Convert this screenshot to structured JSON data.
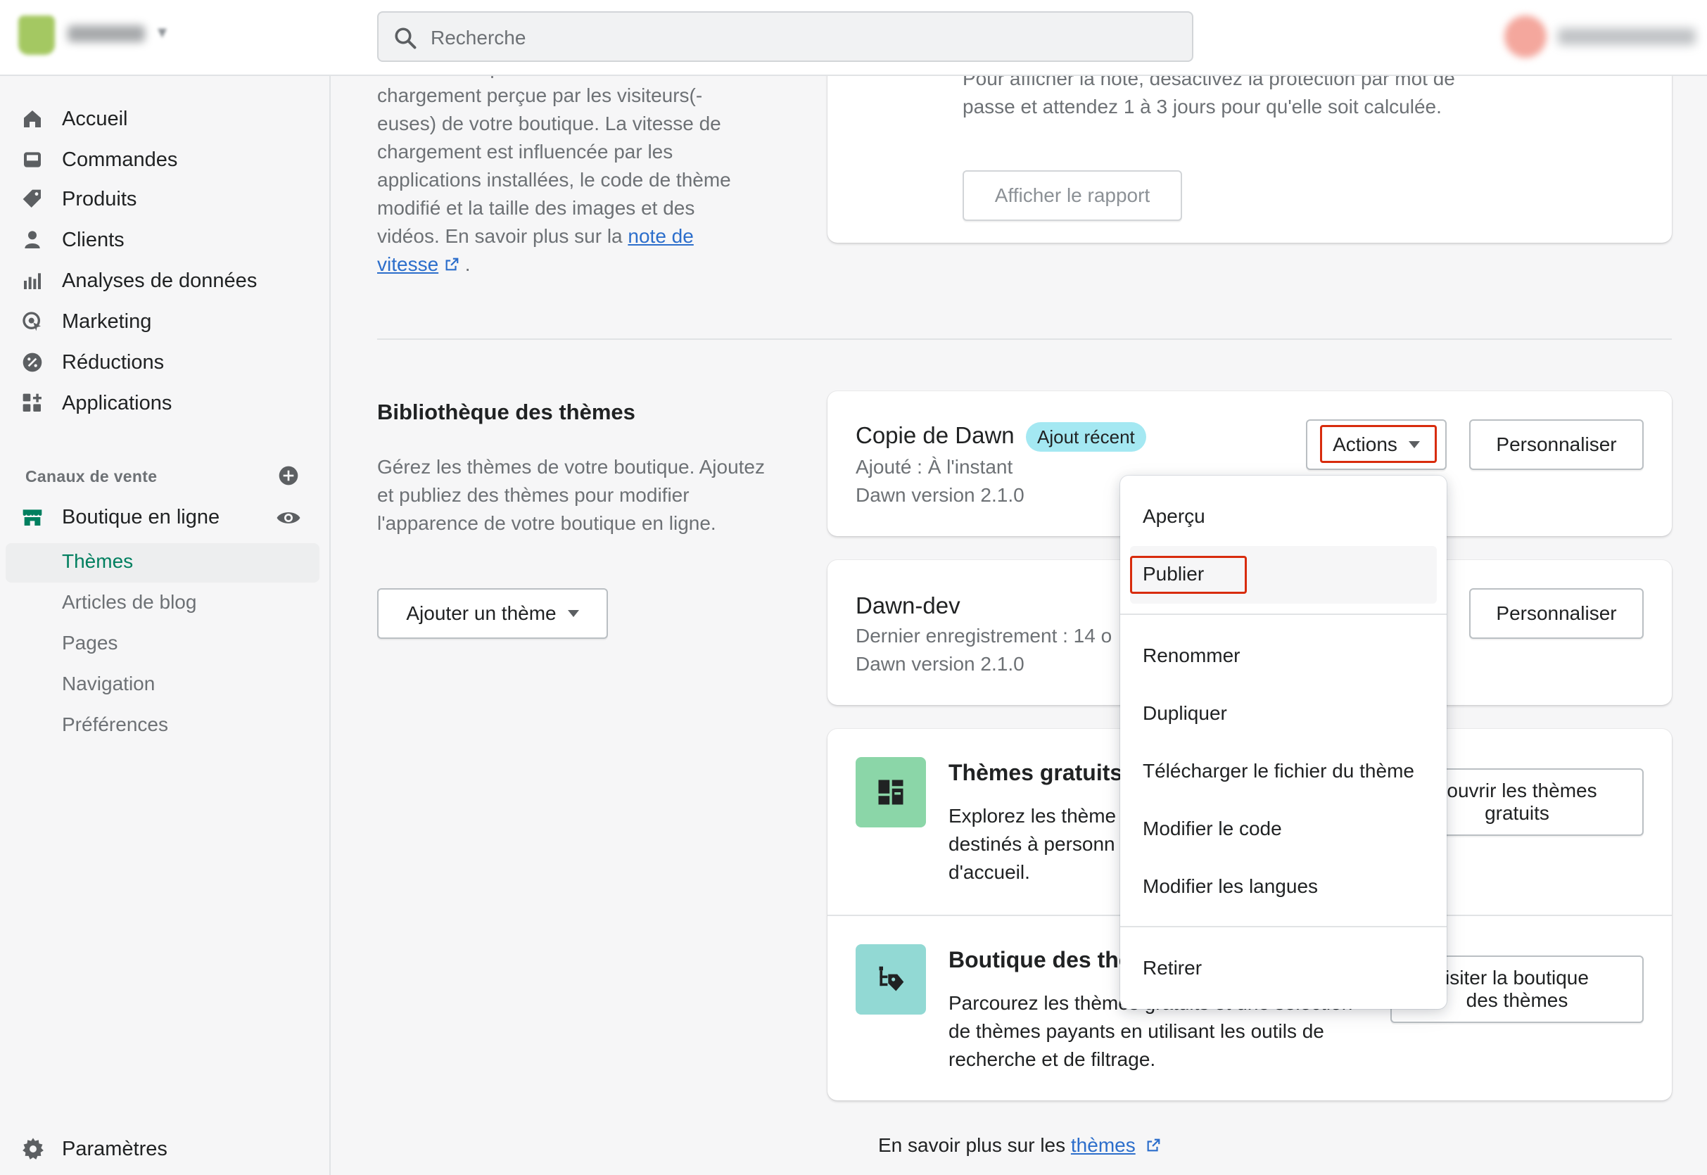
{
  "topbar": {
    "search_placeholder": "Recherche"
  },
  "sidebar": {
    "items": [
      {
        "label": "Accueil",
        "icon": "home-icon"
      },
      {
        "label": "Commandes",
        "icon": "inbox-icon"
      },
      {
        "label": "Produits",
        "icon": "tag-icon"
      },
      {
        "label": "Clients",
        "icon": "person-icon"
      },
      {
        "label": "Analyses de données",
        "icon": "bar-chart-icon"
      },
      {
        "label": "Marketing",
        "icon": "target-icon"
      },
      {
        "label": "Réductions",
        "icon": "discount-icon"
      },
      {
        "label": "Applications",
        "icon": "apps-icon"
      }
    ],
    "sales_channels_label": "Canaux de vente",
    "online_store_label": "Boutique en ligne",
    "sub_items": [
      "Thèmes",
      "Articles de blog",
      "Pages",
      "Navigation",
      "Préférences"
    ],
    "settings_label": "Paramètres"
  },
  "speed": {
    "text_before": "Votre note représente la vitesse de chargement perçue par les visiteurs(-euses) de votre boutique. La vitesse de chargement est influencée par les applications installées, le code de thème modifié et la taille des images et des vidéos. En savoir plus sur la ",
    "link": "note de vitesse",
    "text_after": " .",
    "card_text": "Pour afficher la note, désactivez la protection par mot de passe et attendez 1 à 3 jours pour qu'elle soit calculée.",
    "report_button": "Afficher le rapport"
  },
  "library": {
    "title": "Bibliothèque des thèmes",
    "description": "Gérez les thèmes de votre boutique. Ajoutez et publiez des thèmes pour modifier l'apparence de votre boutique en ligne.",
    "add_button": "Ajouter un thème"
  },
  "themes": [
    {
      "name": "Copie de Dawn",
      "badge": "Ajout récent",
      "meta1": "Ajouté : À l'instant",
      "meta2": "Dawn version 2.1.0",
      "actions": "Actions",
      "customize": "Personnaliser"
    },
    {
      "name": "Dawn-dev",
      "meta1": "Dernier enregistrement : 14 o",
      "meta2": "Dawn version 2.1.0",
      "customize": "Personnaliser"
    }
  ],
  "free_themes": {
    "title": "Thèmes gratuits",
    "text": "Explorez les thème destinés à personn d'accueil.",
    "button_line1": "couvrir les thèmes",
    "button_line2": "gratuits"
  },
  "theme_store": {
    "title": "Boutique des thè",
    "text": "Parcourez les thèmes gratuits et une sélection de thèmes payants en utilisant les outils de recherche et de filtrage.",
    "button_line1": "isiter la boutique",
    "button_line2": "des thèmes"
  },
  "footer": {
    "text": "En savoir plus sur les ",
    "link": "thèmes"
  },
  "dropdown": {
    "items": [
      "Aperçu",
      "Publier",
      "Renommer",
      "Dupliquer",
      "Télécharger le fichier du thème",
      "Modifier le code",
      "Modifier les langues",
      "Retirer"
    ]
  },
  "colors": {
    "accent_green": "#007f5f",
    "link_blue": "#2c6ecb",
    "badge_bg": "#a4e8f2",
    "highlight_red": "#d82c0d"
  }
}
